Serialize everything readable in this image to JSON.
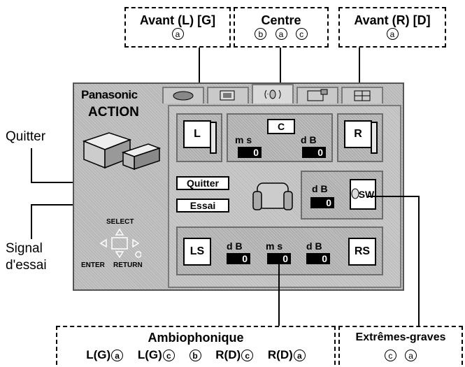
{
  "callouts": {
    "front_left": {
      "title": "Avant (L) [G]",
      "codes": [
        "a"
      ]
    },
    "center": {
      "title": "Centre",
      "codes": [
        "b",
        "a",
        "c"
      ]
    },
    "front_right": {
      "title": "Avant (R) [D]",
      "codes": [
        "a"
      ]
    },
    "surround": {
      "title": "Ambiophonique",
      "items": [
        {
          "label": "L(G)",
          "code": "a"
        },
        {
          "label": "L(G)",
          "code": "c"
        },
        {
          "label": "",
          "code": "b"
        },
        {
          "label": "R(D)",
          "code": "c"
        },
        {
          "label": "R(D)",
          "code": "a"
        }
      ]
    },
    "subwoofer": {
      "title": "Extrêmes-graves",
      "codes": [
        "c",
        "a"
      ]
    }
  },
  "side_labels": {
    "quit": "Quitter",
    "test_line1": "Signal",
    "test_line2": "d'essai"
  },
  "panel": {
    "brand": "Panasonic",
    "mode": "ACTION",
    "tabs": [
      "tab-1",
      "tab-2",
      "tab-3",
      "tab-4",
      "tab-5"
    ],
    "active_tab": 2,
    "select_label": "SELECT",
    "enter_label": "ENTER",
    "return_label": "RETURN",
    "front_left": {
      "label": "L"
    },
    "front_right": {
      "label": "R"
    },
    "center": {
      "label": "C",
      "delay_unit": "m s",
      "delay_value": "0",
      "level_unit": "d B",
      "level_value": "0"
    },
    "subwoofer": {
      "label": "SW",
      "level_unit": "d B",
      "level_value": "0"
    },
    "surround": {
      "left_label": "LS",
      "right_label": "RS",
      "left_level_unit": "d B",
      "left_level_value": "0",
      "delay_unit": "m s",
      "delay_value": "0",
      "right_level_unit": "d B",
      "right_level_value": "0"
    },
    "quit_button": "Quitter",
    "test_button": "Essai"
  },
  "colors": {
    "panel": "#b7b7b7",
    "inner": "#c9c9c9",
    "value_bg": "#000000",
    "value_fg": "#ffffff"
  }
}
